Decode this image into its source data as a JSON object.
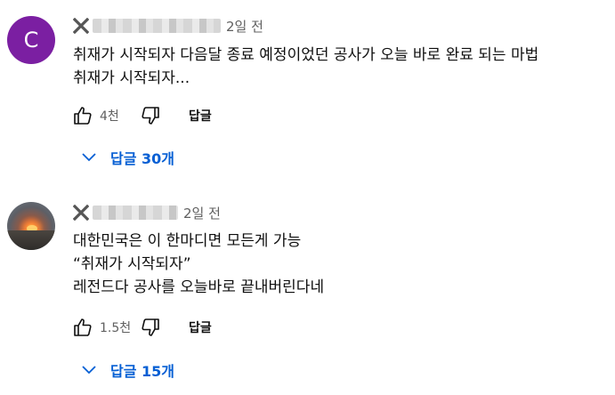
{
  "comments": [
    {
      "avatar_letter": "C",
      "time": "2일 전",
      "lines": [
        "취재가 시작되자 다음달 종료 예정이었던 공사가 오늘 바로 완료 되는 마법",
        "취재가 시작되자..."
      ],
      "like_count": "4천",
      "reply_label": "답글",
      "replies_toggle": "답글 30개"
    },
    {
      "avatar_letter": "",
      "time": "2일 전",
      "lines": [
        "대한민국은 이 한마디면 모든게 가능",
        "“취재가 시작되자”",
        "레전드다 공사를 오늘바로 끝내버린다네"
      ],
      "like_count": "1.5천",
      "reply_label": "답글",
      "replies_toggle": "답글 15개"
    }
  ],
  "colors": {
    "accent": "#065fd4",
    "avatar_c": "#7b1fa2",
    "meta": "#606060"
  },
  "icons": [
    "x-mark-icon",
    "thumbs-up-icon",
    "thumbs-down-icon",
    "chevron-down-icon"
  ]
}
